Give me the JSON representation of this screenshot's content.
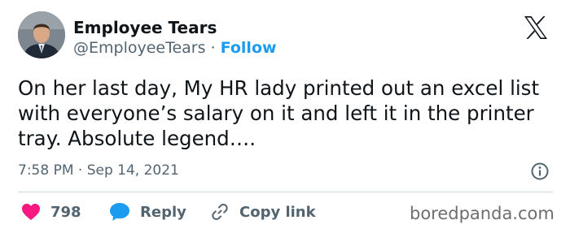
{
  "author": {
    "name": "Employee Tears",
    "handle": "@EmployeeTears",
    "separator": " · ",
    "follow_label": "Follow"
  },
  "tweet": {
    "text": "On her last day, My HR lady printed out an excel list with everyone’s salary on it and left it in the printer tray. Absolute legend….",
    "timestamp": "7:58 PM · Sep 14, 2021"
  },
  "actions": {
    "like_count": "798",
    "reply_label": "Reply",
    "copy_link_label": "Copy link"
  },
  "watermark": "boredpanda.com",
  "icons": {
    "platform": "x-logo-icon",
    "info": "info-icon",
    "like": "heart-icon",
    "reply": "speech-bubble-icon",
    "copy_link": "link-icon"
  },
  "colors": {
    "follow": "#1d9bf0",
    "heart": "#f91880",
    "reply_bubble": "#1d9bf0",
    "secondary_text": "#536471",
    "divider": "#cfd9de"
  }
}
